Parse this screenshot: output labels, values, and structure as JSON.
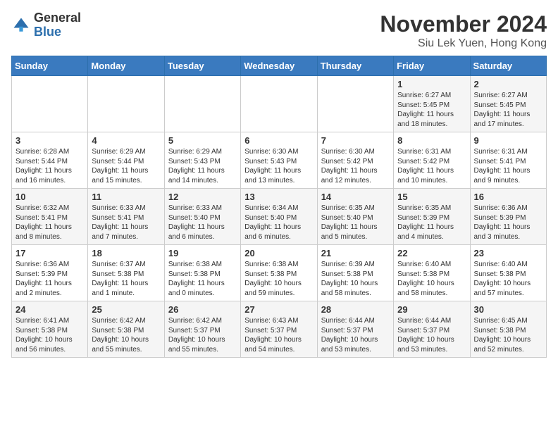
{
  "header": {
    "logo_line1": "General",
    "logo_line2": "Blue",
    "title": "November 2024",
    "subtitle": "Siu Lek Yuen, Hong Kong"
  },
  "days_of_week": [
    "Sunday",
    "Monday",
    "Tuesday",
    "Wednesday",
    "Thursday",
    "Friday",
    "Saturday"
  ],
  "weeks": [
    [
      {
        "day": "",
        "info": ""
      },
      {
        "day": "",
        "info": ""
      },
      {
        "day": "",
        "info": ""
      },
      {
        "day": "",
        "info": ""
      },
      {
        "day": "",
        "info": ""
      },
      {
        "day": "1",
        "info": "Sunrise: 6:27 AM\nSunset: 5:45 PM\nDaylight: 11 hours and 18 minutes."
      },
      {
        "day": "2",
        "info": "Sunrise: 6:27 AM\nSunset: 5:45 PM\nDaylight: 11 hours and 17 minutes."
      }
    ],
    [
      {
        "day": "3",
        "info": "Sunrise: 6:28 AM\nSunset: 5:44 PM\nDaylight: 11 hours and 16 minutes."
      },
      {
        "day": "4",
        "info": "Sunrise: 6:29 AM\nSunset: 5:44 PM\nDaylight: 11 hours and 15 minutes."
      },
      {
        "day": "5",
        "info": "Sunrise: 6:29 AM\nSunset: 5:43 PM\nDaylight: 11 hours and 14 minutes."
      },
      {
        "day": "6",
        "info": "Sunrise: 6:30 AM\nSunset: 5:43 PM\nDaylight: 11 hours and 13 minutes."
      },
      {
        "day": "7",
        "info": "Sunrise: 6:30 AM\nSunset: 5:42 PM\nDaylight: 11 hours and 12 minutes."
      },
      {
        "day": "8",
        "info": "Sunrise: 6:31 AM\nSunset: 5:42 PM\nDaylight: 11 hours and 10 minutes."
      },
      {
        "day": "9",
        "info": "Sunrise: 6:31 AM\nSunset: 5:41 PM\nDaylight: 11 hours and 9 minutes."
      }
    ],
    [
      {
        "day": "10",
        "info": "Sunrise: 6:32 AM\nSunset: 5:41 PM\nDaylight: 11 hours and 8 minutes."
      },
      {
        "day": "11",
        "info": "Sunrise: 6:33 AM\nSunset: 5:41 PM\nDaylight: 11 hours and 7 minutes."
      },
      {
        "day": "12",
        "info": "Sunrise: 6:33 AM\nSunset: 5:40 PM\nDaylight: 11 hours and 6 minutes."
      },
      {
        "day": "13",
        "info": "Sunrise: 6:34 AM\nSunset: 5:40 PM\nDaylight: 11 hours and 6 minutes."
      },
      {
        "day": "14",
        "info": "Sunrise: 6:35 AM\nSunset: 5:40 PM\nDaylight: 11 hours and 5 minutes."
      },
      {
        "day": "15",
        "info": "Sunrise: 6:35 AM\nSunset: 5:39 PM\nDaylight: 11 hours and 4 minutes."
      },
      {
        "day": "16",
        "info": "Sunrise: 6:36 AM\nSunset: 5:39 PM\nDaylight: 11 hours and 3 minutes."
      }
    ],
    [
      {
        "day": "17",
        "info": "Sunrise: 6:36 AM\nSunset: 5:39 PM\nDaylight: 11 hours and 2 minutes."
      },
      {
        "day": "18",
        "info": "Sunrise: 6:37 AM\nSunset: 5:38 PM\nDaylight: 11 hours and 1 minute."
      },
      {
        "day": "19",
        "info": "Sunrise: 6:38 AM\nSunset: 5:38 PM\nDaylight: 11 hours and 0 minutes."
      },
      {
        "day": "20",
        "info": "Sunrise: 6:38 AM\nSunset: 5:38 PM\nDaylight: 10 hours and 59 minutes."
      },
      {
        "day": "21",
        "info": "Sunrise: 6:39 AM\nSunset: 5:38 PM\nDaylight: 10 hours and 58 minutes."
      },
      {
        "day": "22",
        "info": "Sunrise: 6:40 AM\nSunset: 5:38 PM\nDaylight: 10 hours and 58 minutes."
      },
      {
        "day": "23",
        "info": "Sunrise: 6:40 AM\nSunset: 5:38 PM\nDaylight: 10 hours and 57 minutes."
      }
    ],
    [
      {
        "day": "24",
        "info": "Sunrise: 6:41 AM\nSunset: 5:38 PM\nDaylight: 10 hours and 56 minutes."
      },
      {
        "day": "25",
        "info": "Sunrise: 6:42 AM\nSunset: 5:38 PM\nDaylight: 10 hours and 55 minutes."
      },
      {
        "day": "26",
        "info": "Sunrise: 6:42 AM\nSunset: 5:37 PM\nDaylight: 10 hours and 55 minutes."
      },
      {
        "day": "27",
        "info": "Sunrise: 6:43 AM\nSunset: 5:37 PM\nDaylight: 10 hours and 54 minutes."
      },
      {
        "day": "28",
        "info": "Sunrise: 6:44 AM\nSunset: 5:37 PM\nDaylight: 10 hours and 53 minutes."
      },
      {
        "day": "29",
        "info": "Sunrise: 6:44 AM\nSunset: 5:37 PM\nDaylight: 10 hours and 53 minutes."
      },
      {
        "day": "30",
        "info": "Sunrise: 6:45 AM\nSunset: 5:38 PM\nDaylight: 10 hours and 52 minutes."
      }
    ]
  ]
}
